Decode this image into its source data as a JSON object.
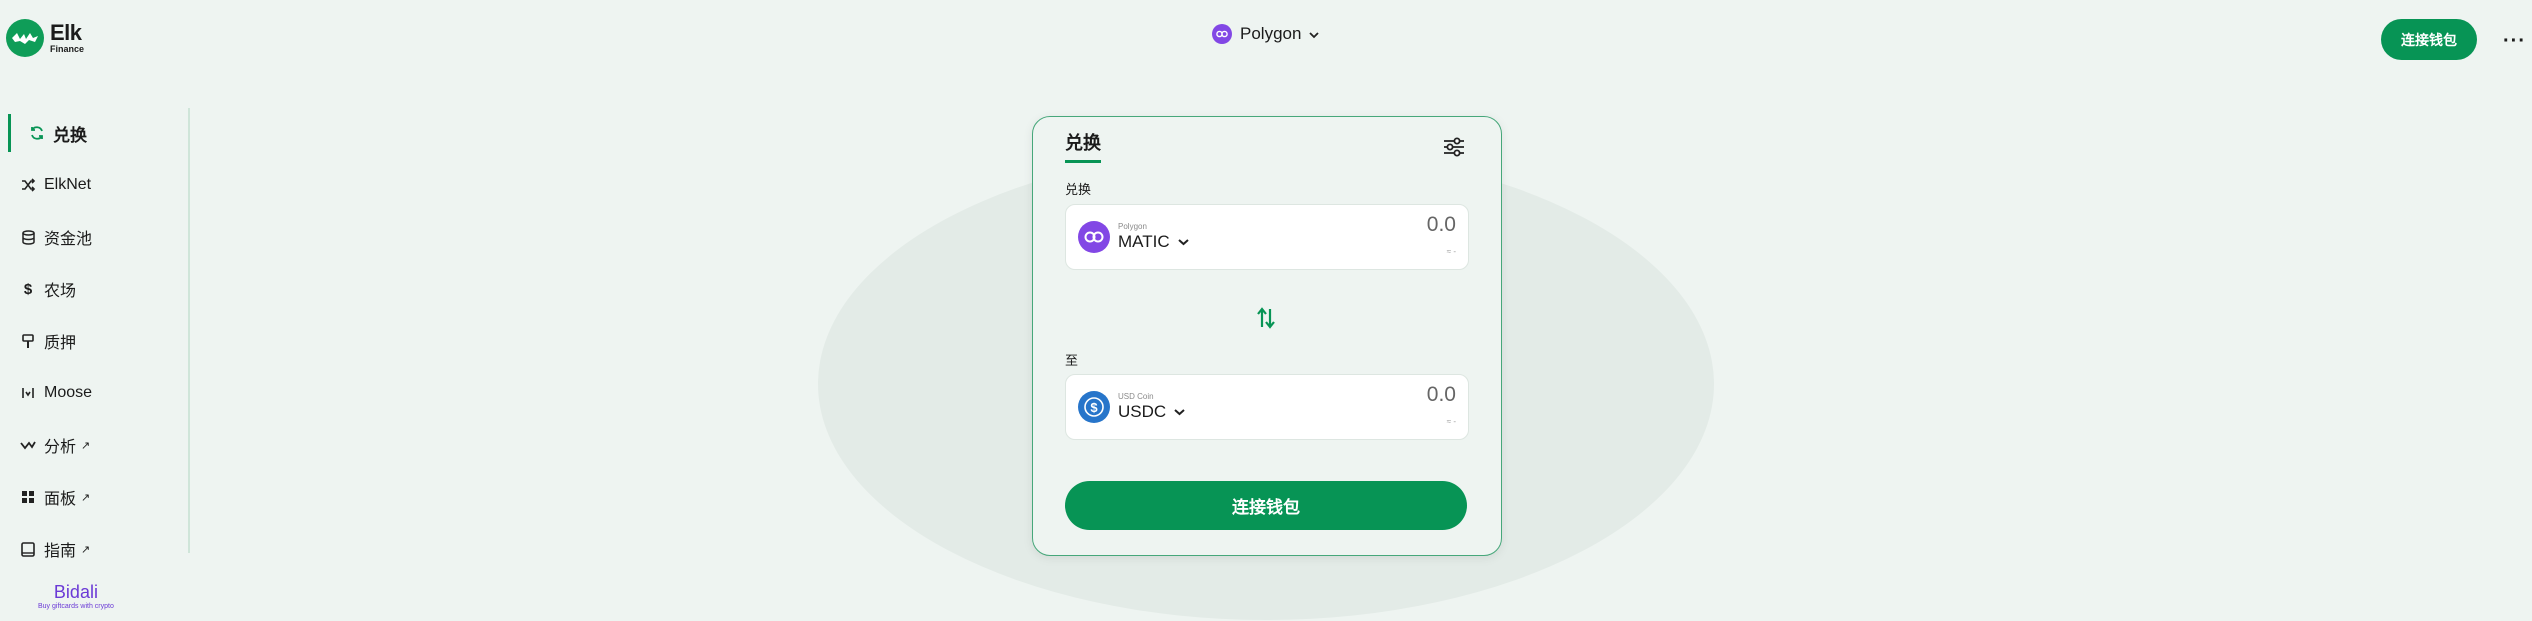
{
  "brand": {
    "name": "Elk",
    "sub": "Finance"
  },
  "header": {
    "network": "Polygon",
    "connect_label": "连接钱包",
    "more": "···"
  },
  "sidebar": {
    "items": [
      {
        "label": "兑换",
        "icon": "refresh-icon"
      },
      {
        "label": "ElkNet",
        "icon": "shuffle-icon"
      },
      {
        "label": "资金池",
        "icon": "database-icon"
      },
      {
        "label": "农场",
        "icon": "dollar-icon"
      },
      {
        "label": "质押",
        "icon": "stake-icon"
      },
      {
        "label": "Moose",
        "icon": "moose-icon"
      },
      {
        "label": "分析",
        "icon": "chart-line-icon",
        "external": "↗"
      },
      {
        "label": "面板",
        "icon": "dashboard-icon",
        "external": "↗"
      },
      {
        "label": "指南",
        "icon": "book-icon",
        "external": "↗"
      }
    ]
  },
  "bidali": {
    "name": "Bidali",
    "tagline": "Buy giftcards with crypto"
  },
  "swap": {
    "title": "兑换",
    "from_label": "兑换",
    "to_label": "至",
    "from": {
      "chain": "Polygon",
      "symbol": "MATIC",
      "amount": "0.0",
      "sub": "≈ -"
    },
    "to": {
      "chain": "USD Coin",
      "symbol": "USDC",
      "amount": "0.0",
      "sub": "≈ -"
    },
    "connect_label": "连接钱包"
  },
  "colors": {
    "accent": "#079455",
    "polygon": "#8247e5",
    "usdc": "#2775ca",
    "bg": "#eef4f1"
  }
}
